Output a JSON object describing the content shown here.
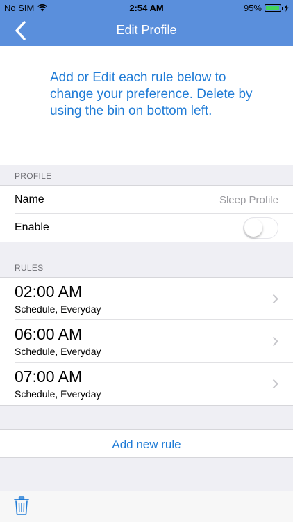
{
  "status_bar": {
    "carrier": "No SIM",
    "time": "2:54 AM",
    "battery_percent": "95%",
    "battery_level": 0.95,
    "icons": [
      "wifi-icon",
      "battery-icon",
      "charging-bolt-icon"
    ]
  },
  "nav": {
    "title": "Edit Profile",
    "back_icon": "chevron-left-icon"
  },
  "intro": {
    "text": "Add or Edit each rule below to change your preference. Delete by using the bin on bottom left."
  },
  "profile_section": {
    "header": "PROFILE",
    "name_label": "Name",
    "name_value": "Sleep Profile",
    "enable_label": "Enable",
    "enable_on": false
  },
  "rules_section": {
    "header": "RULES",
    "rules": [
      {
        "time": "02:00 AM",
        "detail": "Schedule, Everyday"
      },
      {
        "time": "06:00 AM",
        "detail": "Schedule, Everyday"
      },
      {
        "time": "07:00 AM",
        "detail": "Schedule, Everyday"
      }
    ]
  },
  "add_rule_label": "Add new rule",
  "toolbar": {
    "delete_icon": "trash-icon"
  },
  "colors": {
    "nav_background": "#5a8fdc",
    "accent_blue": "#1f7bd6",
    "battery_green": "#43d35a"
  }
}
